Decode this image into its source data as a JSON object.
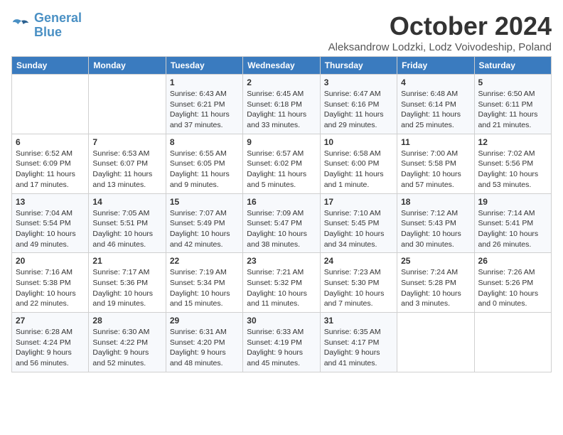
{
  "logo": {
    "line1": "General",
    "line2": "Blue"
  },
  "title": "October 2024",
  "location": "Aleksandrow Lodzki, Lodz Voivodeship, Poland",
  "days_of_week": [
    "Sunday",
    "Monday",
    "Tuesday",
    "Wednesday",
    "Thursday",
    "Friday",
    "Saturday"
  ],
  "weeks": [
    [
      {
        "day": "",
        "info": ""
      },
      {
        "day": "",
        "info": ""
      },
      {
        "day": "1",
        "info": "Sunrise: 6:43 AM\nSunset: 6:21 PM\nDaylight: 11 hours and 37 minutes."
      },
      {
        "day": "2",
        "info": "Sunrise: 6:45 AM\nSunset: 6:18 PM\nDaylight: 11 hours and 33 minutes."
      },
      {
        "day": "3",
        "info": "Sunrise: 6:47 AM\nSunset: 6:16 PM\nDaylight: 11 hours and 29 minutes."
      },
      {
        "day": "4",
        "info": "Sunrise: 6:48 AM\nSunset: 6:14 PM\nDaylight: 11 hours and 25 minutes."
      },
      {
        "day": "5",
        "info": "Sunrise: 6:50 AM\nSunset: 6:11 PM\nDaylight: 11 hours and 21 minutes."
      }
    ],
    [
      {
        "day": "6",
        "info": "Sunrise: 6:52 AM\nSunset: 6:09 PM\nDaylight: 11 hours and 17 minutes."
      },
      {
        "day": "7",
        "info": "Sunrise: 6:53 AM\nSunset: 6:07 PM\nDaylight: 11 hours and 13 minutes."
      },
      {
        "day": "8",
        "info": "Sunrise: 6:55 AM\nSunset: 6:05 PM\nDaylight: 11 hours and 9 minutes."
      },
      {
        "day": "9",
        "info": "Sunrise: 6:57 AM\nSunset: 6:02 PM\nDaylight: 11 hours and 5 minutes."
      },
      {
        "day": "10",
        "info": "Sunrise: 6:58 AM\nSunset: 6:00 PM\nDaylight: 11 hours and 1 minute."
      },
      {
        "day": "11",
        "info": "Sunrise: 7:00 AM\nSunset: 5:58 PM\nDaylight: 10 hours and 57 minutes."
      },
      {
        "day": "12",
        "info": "Sunrise: 7:02 AM\nSunset: 5:56 PM\nDaylight: 10 hours and 53 minutes."
      }
    ],
    [
      {
        "day": "13",
        "info": "Sunrise: 7:04 AM\nSunset: 5:54 PM\nDaylight: 10 hours and 49 minutes."
      },
      {
        "day": "14",
        "info": "Sunrise: 7:05 AM\nSunset: 5:51 PM\nDaylight: 10 hours and 46 minutes."
      },
      {
        "day": "15",
        "info": "Sunrise: 7:07 AM\nSunset: 5:49 PM\nDaylight: 10 hours and 42 minutes."
      },
      {
        "day": "16",
        "info": "Sunrise: 7:09 AM\nSunset: 5:47 PM\nDaylight: 10 hours and 38 minutes."
      },
      {
        "day": "17",
        "info": "Sunrise: 7:10 AM\nSunset: 5:45 PM\nDaylight: 10 hours and 34 minutes."
      },
      {
        "day": "18",
        "info": "Sunrise: 7:12 AM\nSunset: 5:43 PM\nDaylight: 10 hours and 30 minutes."
      },
      {
        "day": "19",
        "info": "Sunrise: 7:14 AM\nSunset: 5:41 PM\nDaylight: 10 hours and 26 minutes."
      }
    ],
    [
      {
        "day": "20",
        "info": "Sunrise: 7:16 AM\nSunset: 5:38 PM\nDaylight: 10 hours and 22 minutes."
      },
      {
        "day": "21",
        "info": "Sunrise: 7:17 AM\nSunset: 5:36 PM\nDaylight: 10 hours and 19 minutes."
      },
      {
        "day": "22",
        "info": "Sunrise: 7:19 AM\nSunset: 5:34 PM\nDaylight: 10 hours and 15 minutes."
      },
      {
        "day": "23",
        "info": "Sunrise: 7:21 AM\nSunset: 5:32 PM\nDaylight: 10 hours and 11 minutes."
      },
      {
        "day": "24",
        "info": "Sunrise: 7:23 AM\nSunset: 5:30 PM\nDaylight: 10 hours and 7 minutes."
      },
      {
        "day": "25",
        "info": "Sunrise: 7:24 AM\nSunset: 5:28 PM\nDaylight: 10 hours and 3 minutes."
      },
      {
        "day": "26",
        "info": "Sunrise: 7:26 AM\nSunset: 5:26 PM\nDaylight: 10 hours and 0 minutes."
      }
    ],
    [
      {
        "day": "27",
        "info": "Sunrise: 6:28 AM\nSunset: 4:24 PM\nDaylight: 9 hours and 56 minutes."
      },
      {
        "day": "28",
        "info": "Sunrise: 6:30 AM\nSunset: 4:22 PM\nDaylight: 9 hours and 52 minutes."
      },
      {
        "day": "29",
        "info": "Sunrise: 6:31 AM\nSunset: 4:20 PM\nDaylight: 9 hours and 48 minutes."
      },
      {
        "day": "30",
        "info": "Sunrise: 6:33 AM\nSunset: 4:19 PM\nDaylight: 9 hours and 45 minutes."
      },
      {
        "day": "31",
        "info": "Sunrise: 6:35 AM\nSunset: 4:17 PM\nDaylight: 9 hours and 41 minutes."
      },
      {
        "day": "",
        "info": ""
      },
      {
        "day": "",
        "info": ""
      }
    ]
  ]
}
